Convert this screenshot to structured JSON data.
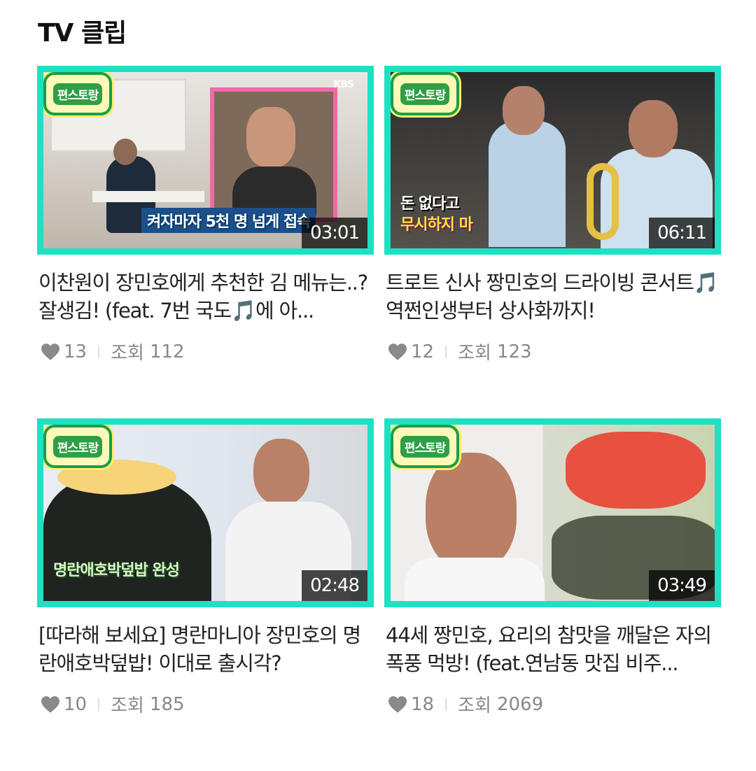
{
  "section": {
    "title": "TV 클립"
  },
  "logo_text": "편스토랑",
  "views_label": "조회",
  "clips": [
    {
      "duration": "03:01",
      "title": "이찬원이 장민호에게 추천한 김 메뉴는..? 잘생김! (feat. 7번 국도🎵에 아...",
      "likes": "13",
      "views": "112",
      "overlay": "켜자마자 5천 명 넘게 접속",
      "broadcaster": "KBS"
    },
    {
      "duration": "06:11",
      "title": "트로트 신사 짱민호의 드라이빙 콘서트🎵 역쩐인생부터 상사화까지!",
      "likes": "12",
      "views": "123",
      "overlay": "무시하지 마",
      "overlay2": "돈 없다고"
    },
    {
      "duration": "02:48",
      "title": "[따라해 보세요] 명란마니아 장민호의 명란애호박덮밥! 이대로 출시각?",
      "likes": "10",
      "views": "185",
      "overlay": "명란애호박덮밥 완성"
    },
    {
      "duration": "03:49",
      "title": "44세 짱민호, 요리의 참맛을 깨달은 자의 폭풍 먹방! (feat.연남동 맛집 비주...",
      "likes": "18",
      "views": "2069"
    }
  ]
}
